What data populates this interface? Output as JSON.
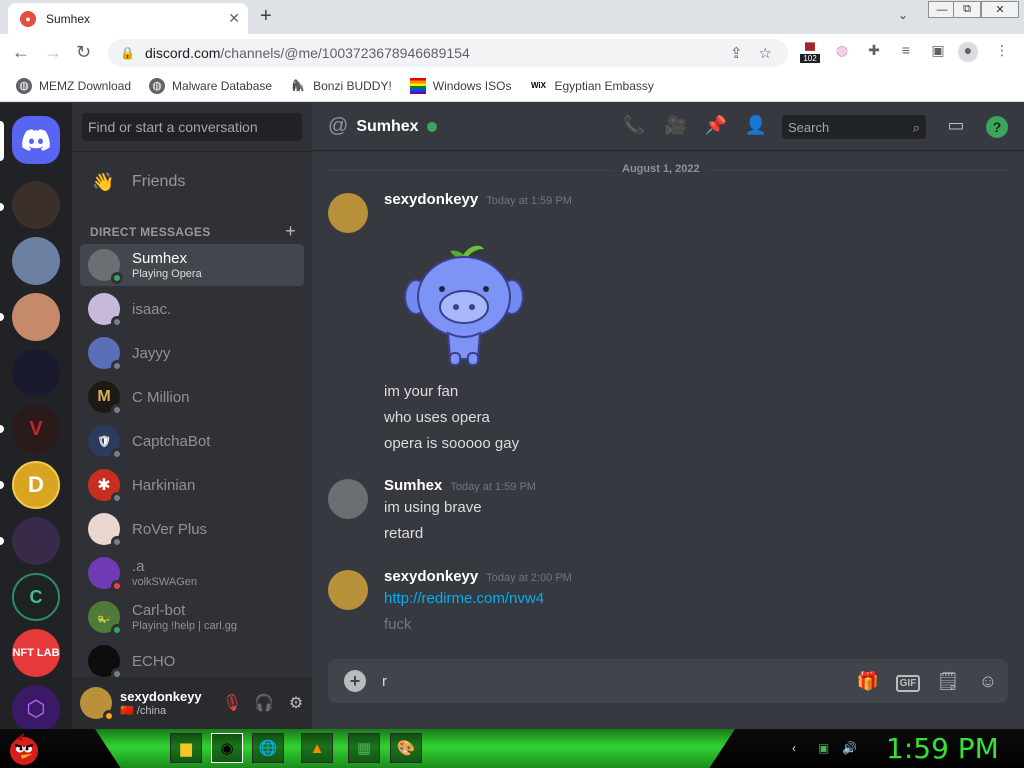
{
  "browser": {
    "tab_title": "Sumhex",
    "tab_close": "✕",
    "new_tab": "+",
    "tab_search": "⌄",
    "win_controls": [
      "—",
      "⧉",
      "✕"
    ],
    "url_host": "discord.com",
    "url_path": "/channels/@me/1003723678946689154",
    "ext_badge": "102",
    "bookmarks": [
      {
        "label": "MEMZ Download",
        "icon": "globe-icon"
      },
      {
        "label": "Malware Database",
        "icon": "globe-icon"
      },
      {
        "label": "Bonzi BUDDY!",
        "icon": "bonzi-icon"
      },
      {
        "label": "Windows ISOs",
        "icon": "rainbow-flag-icon"
      },
      {
        "label": "Egyptian Embassy",
        "icon": "wix-icon"
      }
    ],
    "wix_glyph": "WiX"
  },
  "discord": {
    "dm_search_placeholder": "Find or start a conversation",
    "friends_label": "Friends",
    "dm_header": "DIRECT MESSAGES",
    "dm_plus": "+",
    "dms": [
      {
        "name": "Sumhex",
        "sub": "Playing Opera",
        "status": "on",
        "avatar_color": "#6b6e73",
        "active": true
      },
      {
        "name": "isaac.",
        "sub": "",
        "status": "off",
        "avatar_color": "#c7b9d9",
        "active": false
      },
      {
        "name": "Jayyy",
        "sub": "",
        "status": "off",
        "avatar_color": "#5a6fb8",
        "active": false
      },
      {
        "name": "C Million",
        "sub": "",
        "status": "off",
        "avatar_color": "#1d1a14",
        "active": false
      },
      {
        "name": "CaptchaBot",
        "sub": "",
        "status": "off",
        "avatar_color": "#2a3b5c",
        "active": false
      },
      {
        "name": "Harkinian",
        "sub": "",
        "status": "off",
        "avatar_color": "#c72e1f",
        "active": false
      },
      {
        "name": "RoVer Plus",
        "sub": "",
        "status": "off",
        "avatar_color": "#e8d6cf",
        "active": false
      },
      {
        "name": ".a",
        "sub": "volkSWAGen",
        "status": "dnd",
        "avatar_color": "#6f3bb2",
        "active": false
      },
      {
        "name": "Carl-bot",
        "sub": "Playing !help | carl.gg",
        "status": "on",
        "avatar_color": "#4f7a3a",
        "active": false
      },
      {
        "name": "ECHO",
        "sub": "",
        "status": "off",
        "avatar_color": "#0d0d0d",
        "active": false
      }
    ],
    "user": {
      "name": "sexydonkeyy",
      "status_text": "/china",
      "flag": "🇨🇳"
    },
    "channel_name": "Sumhex",
    "header_search": "Search",
    "help_glyph": "?",
    "date_divider": "August 1, 2022",
    "messages": [
      {
        "author": "sexydonkeyy",
        "time": "Today at 1:59 PM",
        "lines": [
          "im your fan",
          "who uses opera",
          "opera is sooooo gay"
        ]
      },
      {
        "author": "Sumhex",
        "time": "Today at 1:59 PM",
        "lines": [
          "im using brave",
          "retard"
        ]
      },
      {
        "author": "sexydonkeyy",
        "time": "Today at 2:00 PM",
        "lines": [
          "http://redirme.com/nvw4",
          "fuck"
        ]
      }
    ],
    "composer_text": "r",
    "composer_add": "+",
    "gif_label": "GIF",
    "guilds": [
      {
        "label": "",
        "color": "#5865f2"
      },
      {
        "label": "",
        "color": "#3b2f2a"
      },
      {
        "label": "",
        "color": "#6b7fa0"
      },
      {
        "label": "",
        "color": "#c48a6a"
      },
      {
        "label": "",
        "color": "#1a1a2e"
      },
      {
        "label": "",
        "color": "#2a1a1a"
      },
      {
        "label": "D",
        "color": "#d9a521"
      },
      {
        "label": "",
        "color": "#3a2a4a"
      },
      {
        "label": "C",
        "color": "#1d2320"
      },
      {
        "label": "NFT LAB",
        "color": "#e63a3a"
      },
      {
        "label": "",
        "color": "#3a1a66"
      }
    ]
  },
  "taskbar": {
    "clock": "1:59 PM"
  },
  "colors": {
    "blurple": "#5865f2",
    "online": "#3ba55c",
    "link": "#00aff4",
    "taskbar_green": "#33e233"
  }
}
